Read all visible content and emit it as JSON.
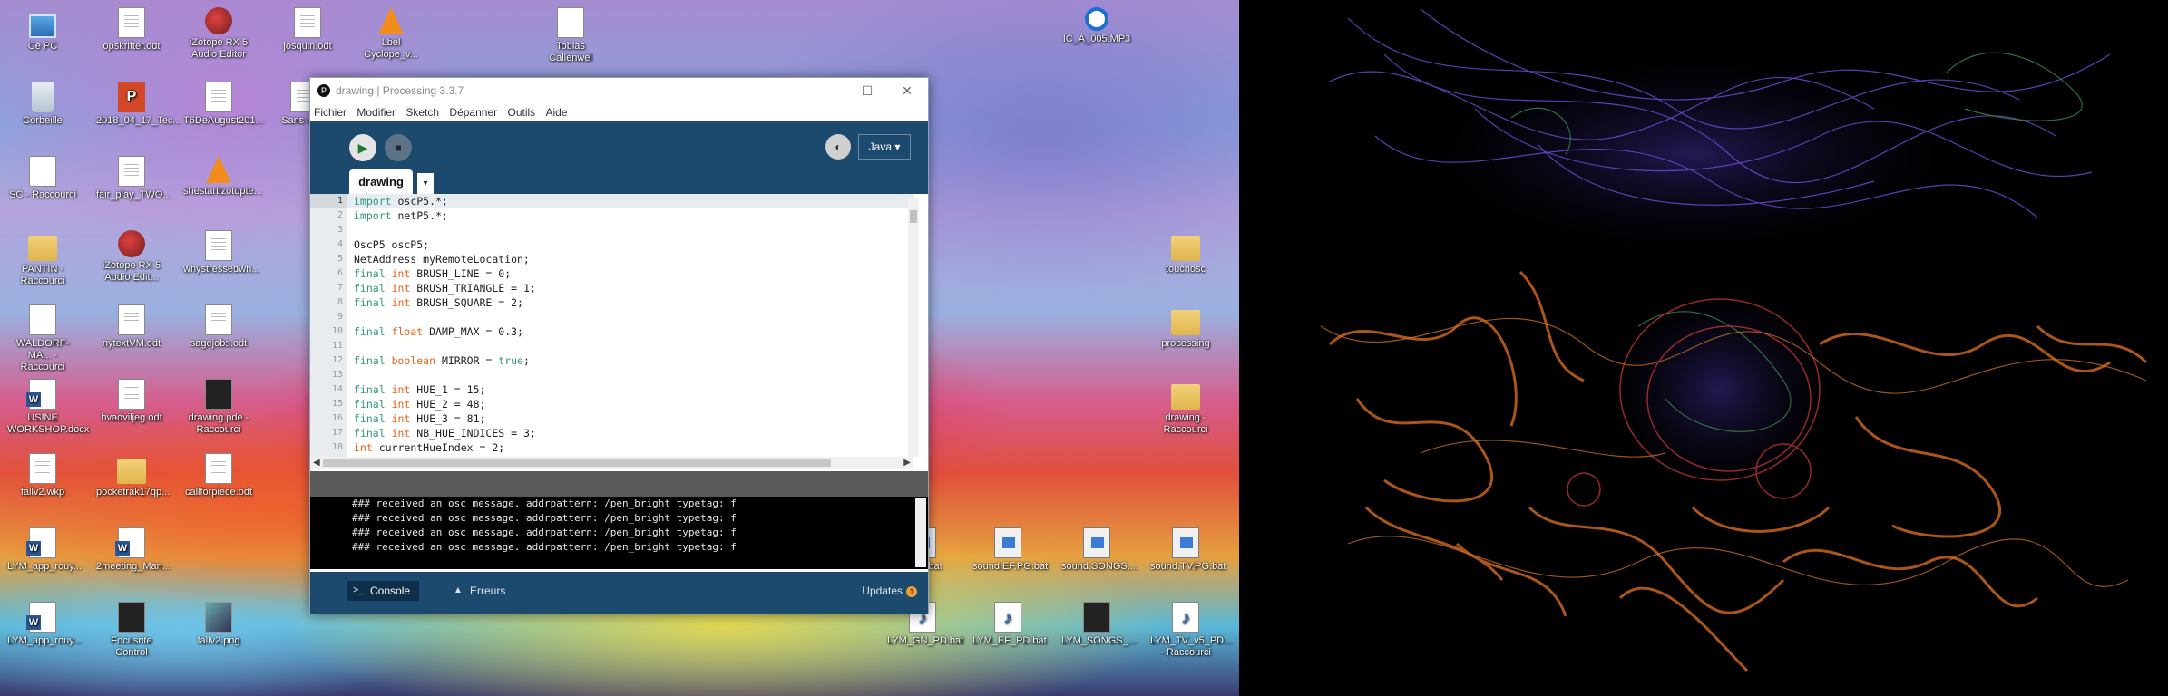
{
  "desktop": {
    "icons": [
      {
        "label": "Ce PC",
        "type": "pc"
      },
      {
        "label": "opskrifter.odt",
        "type": "doc"
      },
      {
        "label": "iZotope RX 5 Audio Editor",
        "type": "izo"
      },
      {
        "label": "josquin.odt",
        "type": "doc"
      },
      {
        "label": "Lbel Cyclope_v...",
        "type": "cone"
      },
      {
        "label": "Tobias Callenwel",
        "type": "link"
      },
      {
        "label": "IC_A_005.MP3",
        "type": "target"
      },
      {
        "label": "Corbeille",
        "type": "bin"
      },
      {
        "label": "2018_04_17_Tec...",
        "type": "ppt"
      },
      {
        "label": "T6DeAugust201...",
        "type": "doc"
      },
      {
        "label": "Sans no...",
        "type": "doc"
      },
      {
        "label": "SC - Raccourci",
        "type": "link"
      },
      {
        "label": "fair_play_TWO...",
        "type": "doc"
      },
      {
        "label": "shestartizotopte...",
        "type": "cone"
      },
      {
        "label": "PANTIN - Raccourci",
        "type": "folder"
      },
      {
        "label": "iZotope RX 5 Audio Edit...",
        "type": "izo"
      },
      {
        "label": "whystressedwh...",
        "type": "doc"
      },
      {
        "label": "touchosc",
        "type": "folder"
      },
      {
        "label": "WALDORF-MA... - Raccourci",
        "type": "link"
      },
      {
        "label": "nytextVM.odt",
        "type": "doc"
      },
      {
        "label": "sagejobs.odt",
        "type": "doc"
      },
      {
        "label": "processing",
        "type": "folder"
      },
      {
        "label": "USINE WORKSHOP.docx",
        "type": "word"
      },
      {
        "label": "hvadviljeg.odt",
        "type": "doc"
      },
      {
        "label": "drawing.pde - Raccourci",
        "type": "dark"
      },
      {
        "label": "drawing - Raccourci",
        "type": "folder"
      },
      {
        "label": "fallv2.wkp",
        "type": "doc"
      },
      {
        "label": "pocketrak17qp...",
        "type": "folder"
      },
      {
        "label": "callforpiece.odt",
        "type": "doc"
      },
      {
        "label": "LYM_app_rouy...",
        "type": "word"
      },
      {
        "label": "2meeting_Man...",
        "type": "word"
      },
      {
        "label": "...PG.bat",
        "type": "bat"
      },
      {
        "label": "sound.EF.PG.bat",
        "type": "bat"
      },
      {
        "label": "sound.SONGS....",
        "type": "bat"
      },
      {
        "label": "sound.TV.PG.bat",
        "type": "bat"
      },
      {
        "label": "LYM_app_rouy...",
        "type": "word"
      },
      {
        "label": "Focusrite Control",
        "type": "dark"
      },
      {
        "label": "fallv2.png",
        "type": "img"
      },
      {
        "label": "LYM_GN_PD.bat",
        "type": "music"
      },
      {
        "label": "LYM_EF_PD.bat",
        "type": "music"
      },
      {
        "label": "LYM_SONGS_...",
        "type": "dark"
      },
      {
        "label": "LYM_TV_v5_PD... - Raccourci",
        "type": "music"
      }
    ]
  },
  "window": {
    "title": "drawing | Processing 3.3.7",
    "app_icon": "processing-icon",
    "minimize": "—",
    "maximize": "☐",
    "close": "✕"
  },
  "menu": [
    "Fichier",
    "Modifier",
    "Sketch",
    "Dépanner",
    "Outils",
    "Aide"
  ],
  "toolbar": {
    "run_glyph": "▶",
    "stop_glyph": "■",
    "debug_glyph": "◐",
    "mode": "Java ▾"
  },
  "tabs": {
    "active": "drawing",
    "menu_glyph": "▾"
  },
  "code_lines": [
    {
      "n": "1",
      "html": "<span class=\"kw\">import</span> oscP5.*;"
    },
    {
      "n": "2",
      "html": "<span class=\"kw\">import</span> netP5.*;"
    },
    {
      "n": "3",
      "html": ""
    },
    {
      "n": "4",
      "html": "OscP5 oscP5;"
    },
    {
      "n": "5",
      "html": "NetAddress myRemoteLocation;"
    },
    {
      "n": "6",
      "html": "<span class=\"kw\">final</span> <span class=\"ty\">int</span> BRUSH_LINE = 0;"
    },
    {
      "n": "7",
      "html": "<span class=\"kw\">final</span> <span class=\"ty\">int</span> BRUSH_TRIANGLE = 1;"
    },
    {
      "n": "8",
      "html": "<span class=\"kw\">final</span> <span class=\"ty\">int</span> BRUSH_SQUARE = 2;"
    },
    {
      "n": "9",
      "html": ""
    },
    {
      "n": "10",
      "html": "<span class=\"kw\">final</span> <span class=\"ty\">float</span> DAMP_MAX = 0.3;"
    },
    {
      "n": "11",
      "html": ""
    },
    {
      "n": "12",
      "html": "<span class=\"kw\">final</span> <span class=\"ty\">boolean</span> MIRROR = <span class=\"lit\">true</span>;"
    },
    {
      "n": "13",
      "html": ""
    },
    {
      "n": "14",
      "html": "<span class=\"kw\">final</span> <span class=\"ty\">int</span> HUE_1 = 15;"
    },
    {
      "n": "15",
      "html": "<span class=\"kw\">final</span> <span class=\"ty\">int</span> HUE_2 = 48;"
    },
    {
      "n": "16",
      "html": "<span class=\"kw\">final</span> <span class=\"ty\">int</span> HUE_3 = 81;"
    },
    {
      "n": "17",
      "html": "<span class=\"kw\">final</span> <span class=\"ty\">int</span> NB_HUE_INDICES = 3;"
    },
    {
      "n": "18",
      "html": "<span class=\"ty\">int</span> currentHueIndex = 2;"
    }
  ],
  "console_lines": [
    "### received an osc message. addrpattern: /pen_bright typetag: f",
    "### received an osc message. addrpattern: /pen_bright typetag: f",
    "### received an osc message. addrpattern: /pen_bright typetag: f",
    "### received an osc message. addrpattern: /pen_bright typetag: f"
  ],
  "bottom_tabs": {
    "console": "Console",
    "errors": "Erreurs",
    "updates": "Updates",
    "updates_count": "1"
  },
  "colors": {
    "toolbar_bg": "#1c4a6e",
    "keyword": "#33997e",
    "type": "#e2661a"
  }
}
